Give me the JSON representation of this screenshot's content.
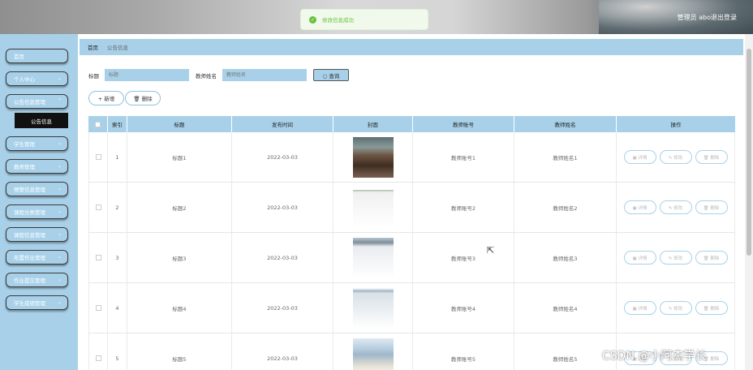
{
  "header": {
    "user_label": "管理员 abo",
    "logout_label": "退出登录"
  },
  "toast": {
    "message": "修改信息成功",
    "check_icon": "✓"
  },
  "sidebar": {
    "items": [
      {
        "label": "首页",
        "chevron": ""
      },
      {
        "label": "个人中心",
        "chevron": "⌄"
      },
      {
        "label": "公告信息管理",
        "chevron": "⌃"
      },
      {
        "label": "学生管理",
        "chevron": "⌄"
      },
      {
        "label": "教师管理",
        "chevron": "⌄"
      },
      {
        "label": "预警信息管理",
        "chevron": "⌄"
      },
      {
        "label": "课程分类管理",
        "chevron": "⌄"
      },
      {
        "label": "课程信息管理",
        "chevron": "⌄"
      },
      {
        "label": "布置作业管理",
        "chevron": "⌄"
      },
      {
        "label": "作业提交管理",
        "chevron": "⌄"
      },
      {
        "label": "学生成绩管理",
        "chevron": "⌄"
      }
    ],
    "active_sub": "公告信息"
  },
  "breadcrumb": {
    "home": "首页",
    "current": "公告信息"
  },
  "search": {
    "title_label": "标题",
    "title_placeholder": "标题",
    "teacher_label": "教师姓名",
    "teacher_placeholder": "教师姓名",
    "button_label": "○ 查询"
  },
  "actions": {
    "add_label": "+ 新增",
    "delete_label": "🗑 删除"
  },
  "table": {
    "headers": [
      "",
      "索引",
      "标题",
      "发布时间",
      "封面",
      "教师账号",
      "教师姓名",
      "操作"
    ],
    "rows": [
      {
        "index": "1",
        "title": "标题1",
        "date": "2022-03-03",
        "account": "教师账号1",
        "name": "教师姓名1"
      },
      {
        "index": "2",
        "title": "标题2",
        "date": "2022-03-03",
        "account": "教师账号2",
        "name": "教师姓名2"
      },
      {
        "index": "3",
        "title": "标题3",
        "date": "2022-03-03",
        "account": "教师账号3",
        "name": "教师姓名3"
      },
      {
        "index": "4",
        "title": "标题4",
        "date": "2022-03-03",
        "account": "教师账号4",
        "name": "教师姓名4"
      },
      {
        "index": "5",
        "title": "标题5",
        "date": "2022-03-03",
        "account": "教师账号5",
        "name": "教师姓名5"
      }
    ],
    "op_detail": "▣ 详情",
    "op_edit": "✎ 修改",
    "op_delete": "🗑 删除"
  },
  "watermark": "CSDN @小阿杰学长"
}
